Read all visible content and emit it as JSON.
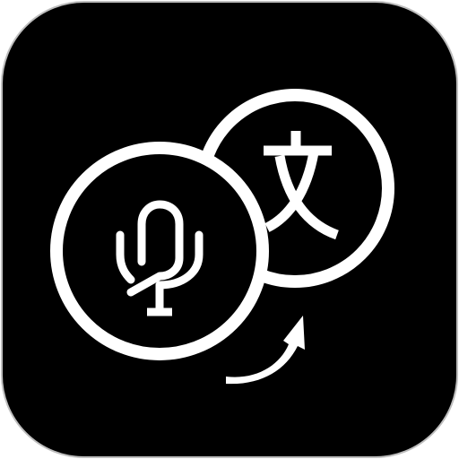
{
  "icon": {
    "name": "voice-translator-app-icon",
    "symbols": [
      "microphone-icon",
      "translate-character-icon",
      "curved-arrow-icon"
    ],
    "translate_glyph": "文",
    "colors": {
      "tile_background": "#000000",
      "tile_border": "#bdbdbd",
      "foreground": "#ffffff",
      "page_background": "#ffffff"
    }
  }
}
